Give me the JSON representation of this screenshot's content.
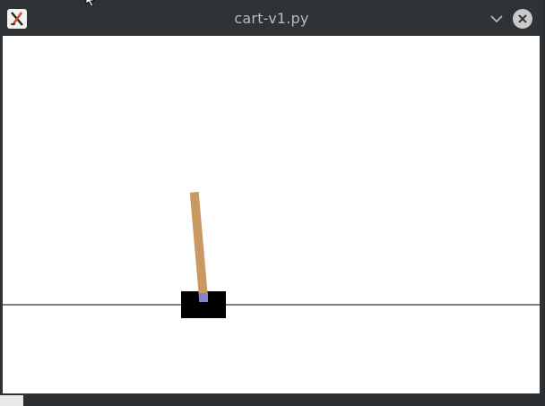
{
  "window": {
    "title": "cart-v1.py",
    "app_icon": "x-app-icon",
    "controls": [
      "chevron-down-icon",
      "close-icon"
    ]
  },
  "scene": {
    "track_color": "#000000",
    "cart_color": "#000000",
    "pole_color": "#ca9865",
    "axle_color": "#8184cb",
    "background": "#ffffff",
    "pole_angle_deg": 5
  }
}
